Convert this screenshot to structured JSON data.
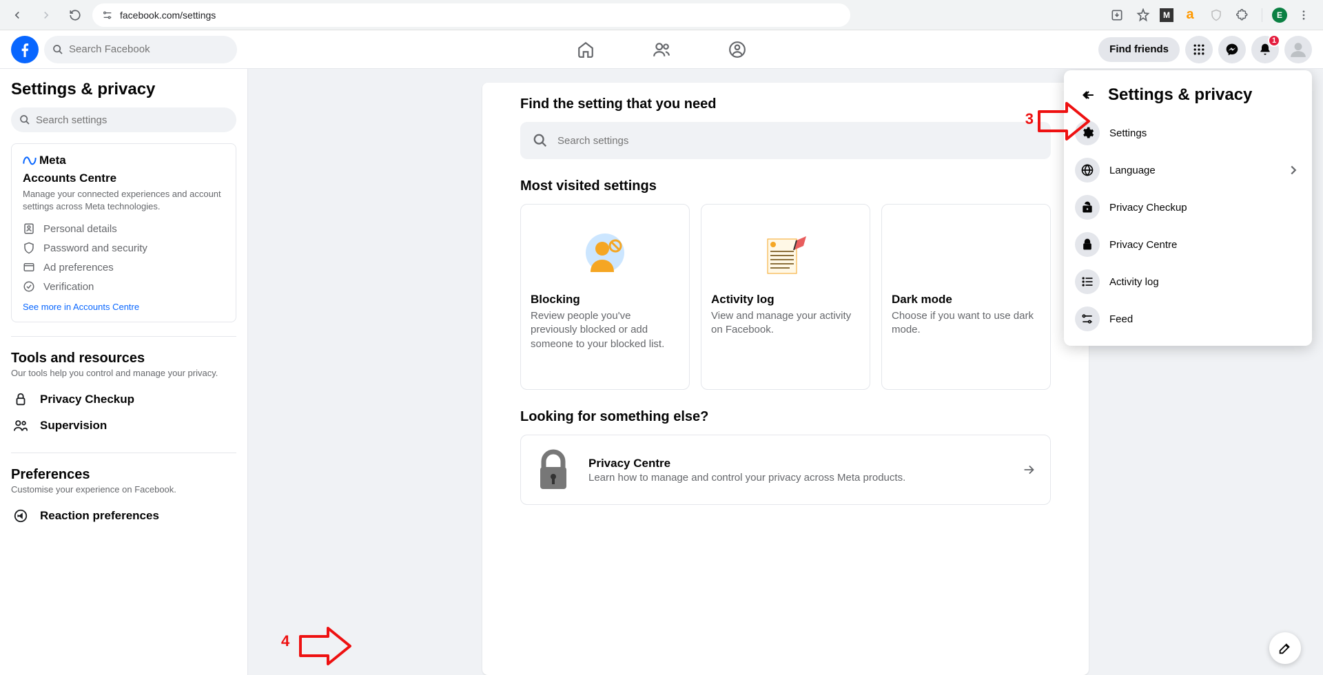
{
  "browser": {
    "url": "facebook.com/settings",
    "profile_letter": "E"
  },
  "fb_header": {
    "search_placeholder": "Search Facebook",
    "find_friends": "Find friends",
    "notif_count": "1"
  },
  "sidebar": {
    "title": "Settings & privacy",
    "search_placeholder": "Search settings",
    "meta_brand": "Meta",
    "accounts_centre": {
      "title": "Accounts Centre",
      "desc": "Manage your connected experiences and account settings across Meta technologies.",
      "rows": [
        "Personal details",
        "Password and security",
        "Ad preferences",
        "Verification"
      ],
      "link": "See more in Accounts Centre"
    },
    "tools": {
      "title": "Tools and resources",
      "sub": "Our tools help you control and manage your privacy.",
      "rows": [
        "Privacy Checkup",
        "Supervision"
      ]
    },
    "prefs": {
      "title": "Preferences",
      "sub": "Customise your experience on Facebook.",
      "rows": [
        "Reaction preferences"
      ]
    }
  },
  "content": {
    "heading": "Find the setting that you need",
    "search_placeholder": "Search settings",
    "most_visited": "Most visited settings",
    "cards": [
      {
        "title": "Blocking",
        "desc": "Review people you've previously blocked or add someone to your blocked list."
      },
      {
        "title": "Activity log",
        "desc": "View and manage your activity on Facebook."
      },
      {
        "title": "Dark mode",
        "desc": "Choose if you want to use dark mode."
      }
    ],
    "else_heading": "Looking for something else?",
    "privacy_centre": {
      "title": "Privacy Centre",
      "desc": "Learn how to manage and control your privacy across Meta products."
    }
  },
  "dropdown": {
    "title": "Settings & privacy",
    "items": [
      {
        "label": "Settings",
        "icon": "gear",
        "chevron": false
      },
      {
        "label": "Language",
        "icon": "globe",
        "chevron": true
      },
      {
        "label": "Privacy Checkup",
        "icon": "lock-open",
        "chevron": false
      },
      {
        "label": "Privacy Centre",
        "icon": "lock",
        "chevron": false
      },
      {
        "label": "Activity log",
        "icon": "list",
        "chevron": false
      },
      {
        "label": "Feed",
        "icon": "feed",
        "chevron": false
      }
    ]
  },
  "annotations": {
    "num3": "3",
    "num4": "4"
  }
}
